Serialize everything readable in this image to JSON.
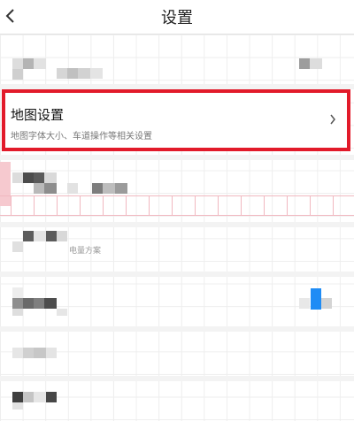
{
  "header": {
    "title": "设置",
    "back_icon": "chevron-left-icon"
  },
  "map_settings": {
    "title": "地图设置",
    "description": "地图字体大小、车道操作等相关设置",
    "chevron_icon": "chevron-right-icon",
    "highlight_color": "#e21a2a"
  },
  "rows": {
    "row_3_faint_text": "电量方案"
  },
  "colors": {
    "accent_blue": "#1f8cf5",
    "pink_accent": "#f6c9cf"
  }
}
